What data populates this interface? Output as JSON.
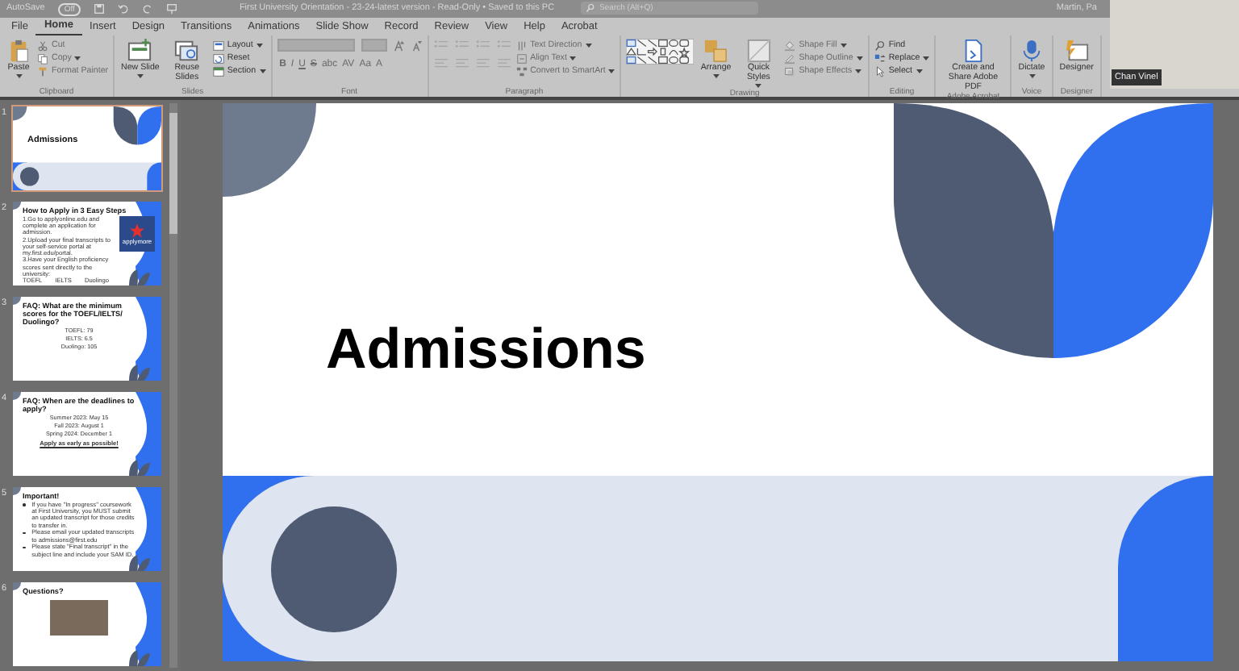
{
  "title_bar": {
    "autosave_label": "AutoSave",
    "autosave_state": "Off",
    "autosave_on": false,
    "document_title": "First University Orientation - 23-24-latest version - Read-Only • Saved to this PC",
    "search_placeholder": "Search (Alt+Q)",
    "user": "Martin, Pa"
  },
  "tabs": [
    {
      "label": "File",
      "selected": false
    },
    {
      "label": "Home",
      "selected": true
    },
    {
      "label": "Insert",
      "selected": false
    },
    {
      "label": "Design",
      "selected": false
    },
    {
      "label": "Transitions",
      "selected": false
    },
    {
      "label": "Animations",
      "selected": false
    },
    {
      "label": "Slide Show",
      "selected": false
    },
    {
      "label": "Record",
      "selected": false
    },
    {
      "label": "Review",
      "selected": false
    },
    {
      "label": "View",
      "selected": false
    },
    {
      "label": "Help",
      "selected": false
    },
    {
      "label": "Acrobat",
      "selected": false
    }
  ],
  "ribbon_groups": [
    {
      "label": "Clipboard",
      "items": [
        {
          "kind": "large",
          "label": "Paste",
          "disabled": false,
          "dropdown": true
        },
        {
          "kind": "small",
          "label": "Cut",
          "disabled": true,
          "dropdown": false
        },
        {
          "kind": "small",
          "label": "Copy",
          "disabled": true,
          "dropdown": true
        },
        {
          "kind": "small",
          "label": "Format Painter",
          "disabled": true,
          "dropdown": false
        }
      ]
    },
    {
      "label": "Slides",
      "items": [
        {
          "kind": "large",
          "label": "New Slide",
          "disabled": false,
          "dropdown": true
        },
        {
          "kind": "large",
          "label": "Reuse Slides",
          "disabled": false,
          "dropdown": false
        },
        {
          "kind": "small",
          "label": "Layout",
          "disabled": false,
          "dropdown": true
        },
        {
          "kind": "small",
          "label": "Reset",
          "disabled": false,
          "dropdown": false
        },
        {
          "kind": "small",
          "label": "Section",
          "disabled": false,
          "dropdown": true
        }
      ]
    },
    {
      "label": "Font",
      "items": [
        {
          "kind": "font_row",
          "disabled": true
        },
        {
          "kind": "glyph",
          "label": "B",
          "disabled": true
        },
        {
          "kind": "glyph",
          "label": "I",
          "disabled": true
        },
        {
          "kind": "glyph",
          "label": "U",
          "disabled": true
        },
        {
          "kind": "glyph",
          "label": "S",
          "disabled": true
        },
        {
          "kind": "glyph",
          "label": "abc",
          "disabled": true
        },
        {
          "kind": "glyph",
          "label": "AV",
          "disabled": true
        },
        {
          "kind": "glyph",
          "label": "Aa",
          "disabled": true
        },
        {
          "kind": "glyph",
          "label": "A",
          "disabled": true
        }
      ]
    },
    {
      "label": "Paragraph",
      "items": [
        {
          "kind": "para",
          "disabled": true
        },
        {
          "kind": "small",
          "label": "Text Direction",
          "disabled": true,
          "dropdown": true
        },
        {
          "kind": "small",
          "label": "Align Text",
          "disabled": true,
          "dropdown": true
        },
        {
          "kind": "small",
          "label": "Convert to SmartArt",
          "disabled": true,
          "dropdown": true
        }
      ]
    },
    {
      "label": "Drawing",
      "items": [
        {
          "kind": "gallery",
          "disabled": false
        },
        {
          "kind": "large",
          "label": "Arrange",
          "disabled": false,
          "dropdown": true
        },
        {
          "kind": "large",
          "label": "Quick Styles",
          "disabled": false,
          "dropdown": true
        },
        {
          "kind": "small",
          "label": "Shape Fill",
          "disabled": true,
          "dropdown": true
        },
        {
          "kind": "small",
          "label": "Shape Outline",
          "disabled": true,
          "dropdown": true
        },
        {
          "kind": "small",
          "label": "Shape Effects",
          "disabled": true,
          "dropdown": true
        }
      ]
    },
    {
      "label": "Editing",
      "items": [
        {
          "kind": "small",
          "label": "Find",
          "disabled": false,
          "dropdown": false
        },
        {
          "kind": "small",
          "label": "Replace",
          "disabled": false,
          "dropdown": true
        },
        {
          "kind": "small",
          "label": "Select",
          "disabled": false,
          "dropdown": true
        }
      ]
    },
    {
      "label": "Adobe Acrobat",
      "items": [
        {
          "kind": "large",
          "label": "Create and Share Adobe PDF",
          "disabled": false,
          "dropdown": false
        }
      ]
    },
    {
      "label": "Voice",
      "items": [
        {
          "kind": "large",
          "label": "Dictate",
          "disabled": false,
          "dropdown": true
        }
      ]
    },
    {
      "label": "Designer",
      "items": [
        {
          "kind": "large",
          "label": "Designer",
          "disabled": false,
          "dropdown": false
        }
      ]
    }
  ],
  "slides": [
    {
      "number": "1",
      "kind": "title",
      "selected": true,
      "title": "Admissions"
    },
    {
      "number": "2",
      "kind": "steps",
      "selected": false,
      "title": "How to Apply in 3 Easy Steps",
      "body": [
        "1.Go to applyonline.edu and complete an application for admission.",
        "2.Upload your final transcripts to your self-service portal at my.first.edu/portal.",
        "3.Have your English proficiency scores sent directly to the university:"
      ],
      "scores": [
        "TOEFL",
        "IELTS",
        "Duolingo"
      ],
      "logo_text": "applymore"
    },
    {
      "number": "3",
      "kind": "centered",
      "selected": false,
      "title": "FAQ: What are the minimum scores for the TOEFL/IELTS/ Duolingo?",
      "body": [
        "TOEFL:   79",
        "IELTS:   6.5",
        "Duolingo:  105"
      ]
    },
    {
      "number": "4",
      "kind": "centered",
      "selected": false,
      "title": "FAQ: When are the deadlines to apply?",
      "body": [
        "Summer 2023: May 15",
        "Fall 2023: August 1",
        "Spring 2024: December 1"
      ],
      "note": "Apply as early as possible!"
    },
    {
      "number": "5",
      "kind": "bullets",
      "selected": false,
      "title": "Important!",
      "body": [
        "If you have \"In progress\" coursework at First University, you MUST submit an updated transcript for those credits to transfer in.",
        "Please email your updated transcripts to admissions@first.edu",
        "Please state \"Final transcript\" in the subject line and include your SAM ID."
      ]
    },
    {
      "number": "6",
      "kind": "photo",
      "selected": false,
      "title": "Questions?"
    }
  ],
  "current_slide": {
    "title": "Admissions"
  },
  "video": {
    "name": "Chan Vinel"
  }
}
